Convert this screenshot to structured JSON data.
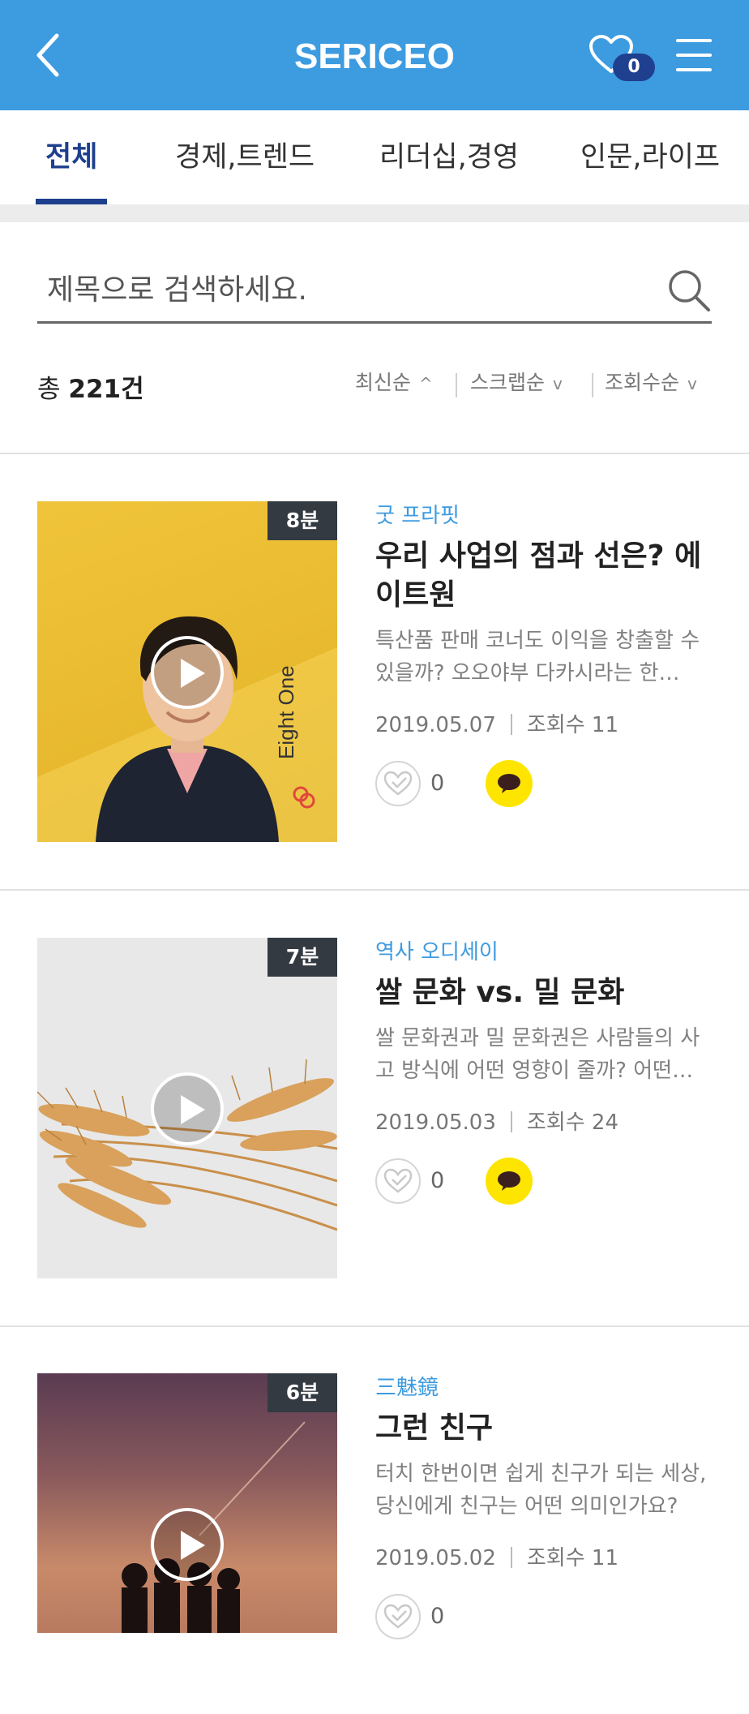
{
  "header": {
    "title": "SERICEO",
    "favorites_count": "0",
    "colors": {
      "bar": "#3d9be0",
      "badge": "#1f3f8f"
    }
  },
  "tabs": [
    {
      "label": "전체",
      "active": true
    },
    {
      "label": "경제,트렌드",
      "active": false
    },
    {
      "label": "리더십,경영",
      "active": false
    },
    {
      "label": "인문,라이프",
      "active": false
    }
  ],
  "search": {
    "placeholder": "제목으로 검색하세요."
  },
  "summary": {
    "prefix": "총",
    "count": "221건"
  },
  "sorts": [
    {
      "label": "최신순",
      "chevron": "^"
    },
    {
      "label": "스크랩순",
      "chevron": "v"
    },
    {
      "label": "조회수순",
      "chevron": "v"
    }
  ],
  "items": [
    {
      "duration": "8분",
      "category": "굿 프라핏",
      "title": "우리 사업의 점과 선은? 에이트원",
      "description": "특산품 판매 코너도 이익을 창출할 수 있을까? 오오야부 다카시라는 한…",
      "date": "2019.05.07",
      "views": "조회수 11",
      "likes": "0",
      "thumb_text": "Eight One"
    },
    {
      "duration": "7분",
      "category": "역사 오디세이",
      "title": "쌀 문화 vs. 밀 문화",
      "description": "쌀 문화권과 밀 문화권은 사람들의 사고 방식에 어떤 영향이 줄까? 어떤…",
      "date": "2019.05.03",
      "views": "조회수 24",
      "likes": "0"
    },
    {
      "duration": "6분",
      "category": "三魅鏡",
      "title": "그런 친구",
      "description": "터치 한번이면 쉽게 친구가 되는 세상, 당신에게 친구는 어떤 의미인가요?",
      "date": "2019.05.02",
      "views": "조회수 11",
      "likes": "0"
    }
  ]
}
